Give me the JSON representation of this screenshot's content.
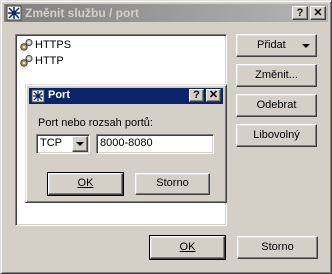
{
  "main_dialog": {
    "title": "Změnit službu / port",
    "help_button": "?",
    "close_button": "✕",
    "services": [
      {
        "label": "HTTPS"
      },
      {
        "label": "HTTP"
      }
    ],
    "add_button": "Přidat",
    "change_button": "Změnit...",
    "remove_button": "Odebrat",
    "any_button": "Libovolný",
    "ok_button": "OK",
    "cancel_button": "Storno"
  },
  "port_dialog": {
    "title": "Port",
    "help_button": "?",
    "close_button": "✕",
    "range_label": "Port nebo rozsah portů:",
    "protocol_value": "TCP",
    "port_value": "8000-8080",
    "ok_button": "OK",
    "cancel_button": "Storno"
  }
}
